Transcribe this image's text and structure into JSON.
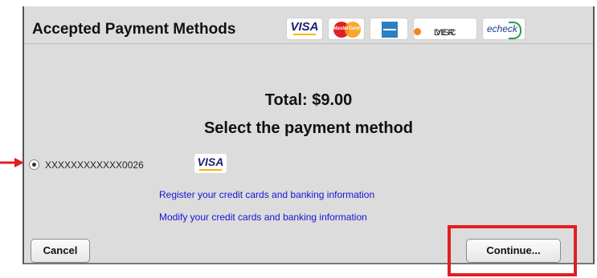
{
  "header": {
    "title": "Accepted Payment Methods",
    "logos": {
      "visa": "VISA",
      "mastercard": "MasterCard",
      "discover": [
        "DISC",
        "VER"
      ],
      "echeck": "echeck"
    }
  },
  "total": "Total:  $9.00",
  "heading": "Select the payment method",
  "payment": {
    "account": "XXXXXXXXXXXX0026",
    "card_brand": "VISA",
    "selected": true
  },
  "links": {
    "register": "Register your credit cards and banking information",
    "modify": "Modify your credit cards and banking information"
  },
  "buttons": {
    "cancel": "Cancel",
    "continue": "Continue..."
  },
  "colors": {
    "panel_bg": "#dcdcdc",
    "link": "#1414d8",
    "highlight": "#e02020",
    "arrow": "#e02020"
  }
}
